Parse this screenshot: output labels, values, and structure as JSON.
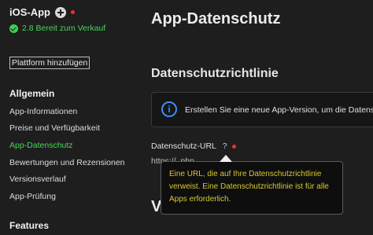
{
  "sidebar": {
    "app_title": "iOS-App",
    "status": "2.8 Bereit zum Verkauf",
    "add_platform": "Plattform hinzufügen",
    "section_general": "Allgemein",
    "items": [
      {
        "label": "App-Informationen",
        "active": false
      },
      {
        "label": "Preise und Verfügbarkeit",
        "active": false
      },
      {
        "label": "App-Datenschutz",
        "active": true
      },
      {
        "label": "Bewertungen und Rezensionen",
        "active": false
      },
      {
        "label": "Versionsverlauf",
        "active": false
      },
      {
        "label": "App-Prüfung",
        "active": false
      }
    ],
    "section_features": "Features"
  },
  "main": {
    "page_title": "App-Datenschutz",
    "section_title": "Datenschutzrichtlinie",
    "info_banner": "Erstellen Sie eine neue App-Version, um die Datense",
    "url_label": "Datenschutz-URL",
    "help_glyph": "?",
    "url_value": "https://                                                    .php",
    "next_heading": "V"
  },
  "tooltip": {
    "text": "Eine URL, die auf Ihre Datenschutzrichtlinie verweist. Eine Datenschutzrichtlinie ist für alle Apps erforderlich."
  },
  "colors": {
    "accent_green": "#49d45b",
    "info_blue": "#3b8ef0",
    "required_red": "#ff2b2b",
    "tooltip_text": "#d8c832"
  },
  "icons": {
    "add": "plus-circle-icon",
    "status": "check-circle-icon",
    "info": "info-circle-icon",
    "help": "question-mark-icon"
  }
}
